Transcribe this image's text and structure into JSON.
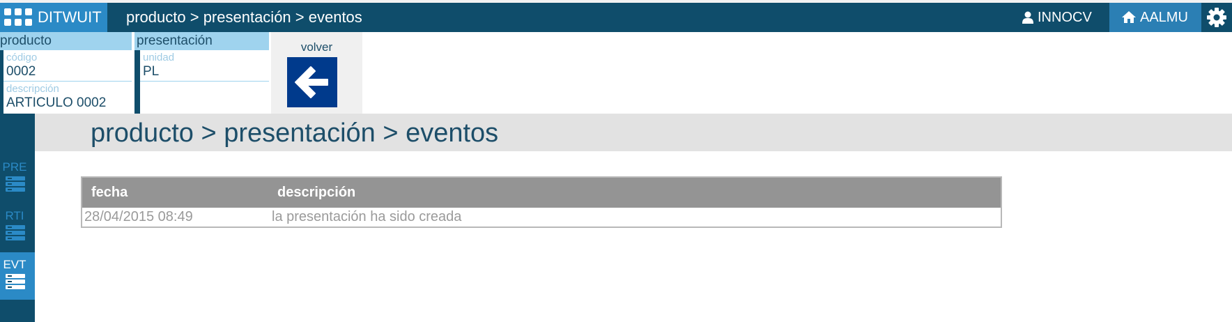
{
  "app": {
    "brand": "DITWUIT",
    "breadcrumb": "producto > presentación > eventos"
  },
  "topbar": {
    "user_label": "INNOCV",
    "home_label": "AALMU",
    "icons": [
      "apps-grid-icon",
      "user-icon",
      "home-icon",
      "gear-icon"
    ]
  },
  "header": {
    "producto": {
      "title": "producto",
      "codigo_label": "código",
      "codigo_value": "0002",
      "descripcion_label": "descripción",
      "descripcion_value": "ARTICULO 0002"
    },
    "presentacion": {
      "title": "presentación",
      "unidad_label": "unidad",
      "unidad_value": "PL"
    },
    "back": {
      "label": "volver",
      "icon": "arrow-left-icon"
    }
  },
  "sidebar": {
    "items": [
      {
        "label": "PRE",
        "active": false
      },
      {
        "label": "RTI",
        "active": false
      },
      {
        "label": "EVT",
        "active": true
      }
    ]
  },
  "main": {
    "title": "producto > presentación > eventos",
    "table": {
      "columns": [
        "fecha",
        "descripción"
      ],
      "rows": [
        {
          "fecha": "28/04/2015 08:49",
          "descripcion": "la presentación ha sido creada"
        }
      ]
    }
  },
  "colors": {
    "navy": "#0f4d6b",
    "brand_blue": "#2b8ac6",
    "light_blue": "#9fd3ee",
    "back_button": "#003a8c",
    "table_header": "#949494"
  }
}
